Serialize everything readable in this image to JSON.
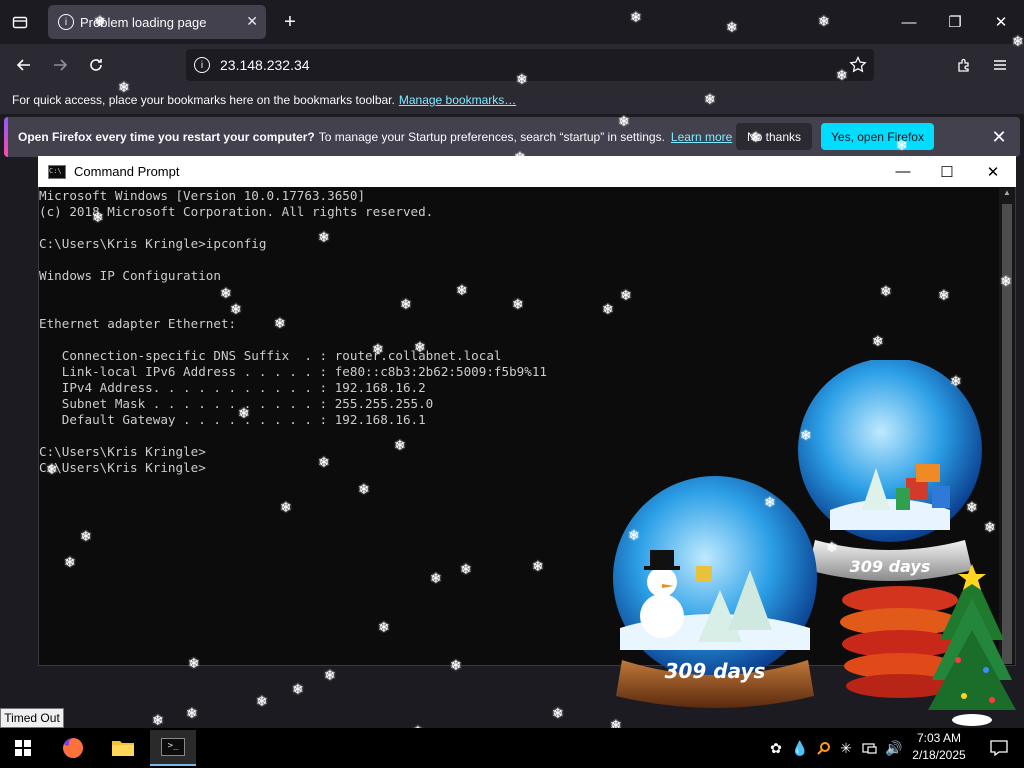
{
  "browser": {
    "tab_title": "Problem loading page",
    "tab_close": "✕",
    "new_tab": "+",
    "url": "23.148.232.34",
    "window_controls": [
      "—",
      "❐",
      "✕"
    ],
    "bookmarks_text": "For quick access, place your bookmarks here on the bookmarks toolbar.",
    "bookmarks_link": "Manage bookmarks…",
    "notification": {
      "bold": "Open Firefox every time you restart your computer?",
      "text": "To manage your Startup preferences, search “startup” in settings.",
      "link": "Learn more",
      "secondary": "No thanks",
      "primary": "Yes, open Firefox"
    }
  },
  "cmd": {
    "title": "Command Prompt",
    "icon_text": "C:\\",
    "controls": [
      "—",
      "☐",
      "✕"
    ],
    "lines": [
      "Microsoft Windows [Version 10.0.17763.3650]",
      "(c) 2018 Microsoft Corporation. All rights reserved.",
      "",
      "C:\\Users\\Kris Kringle>ipconfig",
      "",
      "Windows IP Configuration",
      "",
      "",
      "Ethernet adapter Ethernet:",
      "",
      "   Connection-specific DNS Suffix  . : router.collabnet.local",
      "   Link-local IPv6 Address . . . . . : fe80::c8b3:2b62:5009:f5b9%11",
      "   IPv4 Address. . . . . . . . . . . : 192.168.16.2",
      "   Subnet Mask . . . . . . . . . . . : 255.255.255.0",
      "   Default Gateway . . . . . . . . . : 192.168.16.1",
      "",
      "C:\\Users\\Kris Kringle>",
      "C:\\Users\\Kris Kringle>"
    ]
  },
  "widgets": {
    "globe_front_label": "309 days",
    "globe_back_label": "309 days"
  },
  "tooltip": "Timed Out",
  "taskbar": {
    "time": "7:03 AM",
    "date": "2/18/2025",
    "cmd_icon_text": ">_"
  },
  "colors": {
    "accent_cyan": "#00ddff",
    "link": "#80ebff",
    "console_bg": "#0c0c0c",
    "console_text": "#cccccc"
  }
}
